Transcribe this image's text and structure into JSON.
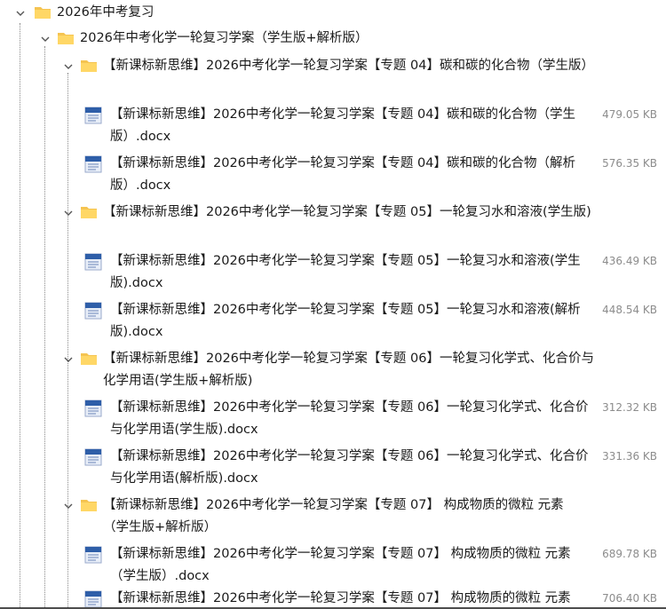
{
  "root": {
    "label": "2026年中考复习"
  },
  "package": {
    "label": "2026年中考化学一轮复习学案（学生版+解析版）"
  },
  "folders": [
    {
      "label": "【新课标新思维】2026中考化学一轮复习学案【专题 04】碳和碳的化合物（学生版）",
      "files": [
        {
          "name": "【新课标新思维】2026中考化学一轮复习学案【专题 04】碳和碳的化合物（学生版）.docx",
          "size": "479.05 KB"
        },
        {
          "name": "【新课标新思维】2026中考化学一轮复习学案【专题 04】碳和碳的化合物（解析版）.docx",
          "size": "576.35 KB"
        }
      ]
    },
    {
      "label": "【新课标新思维】2026中考化学一轮复习学案【专题 05】一轮复习水和溶液(学生版)",
      "files": [
        {
          "name": "【新课标新思维】2026中考化学一轮复习学案【专题 05】一轮复习水和溶液(学生版).docx",
          "size": "436.49 KB"
        },
        {
          "name": "【新课标新思维】2026中考化学一轮复习学案【专题 05】一轮复习水和溶液(解析版).docx",
          "size": "448.54 KB"
        }
      ]
    },
    {
      "label": "【新课标新思维】2026中考化学一轮复习学案【专题 06】一轮复习化学式、化合价与化学用语(学生版+解析版)",
      "files": [
        {
          "name": "【新课标新思维】2026中考化学一轮复习学案【专题 06】一轮复习化学式、化合价与化学用语(学生版).docx",
          "size": "312.32 KB"
        },
        {
          "name": "【新课标新思维】2026中考化学一轮复习学案【专题 06】一轮复习化学式、化合价与化学用语(解析版).docx",
          "size": "331.36 KB"
        }
      ]
    },
    {
      "label": "【新课标新思维】2026中考化学一轮复习学案【专题 07】 构成物质的微粒 元素（学生版+解析版）",
      "files": [
        {
          "name": "【新课标新思维】2026中考化学一轮复习学案【专题 07】 构成物质的微粒 元素（学生版）.docx",
          "size": "689.78 KB"
        },
        {
          "name": "【新课标新思维】2026中考化学一轮复习学案【专题 07】 构成物质的微粒 元素",
          "size": "706.40 KB"
        }
      ]
    }
  ]
}
